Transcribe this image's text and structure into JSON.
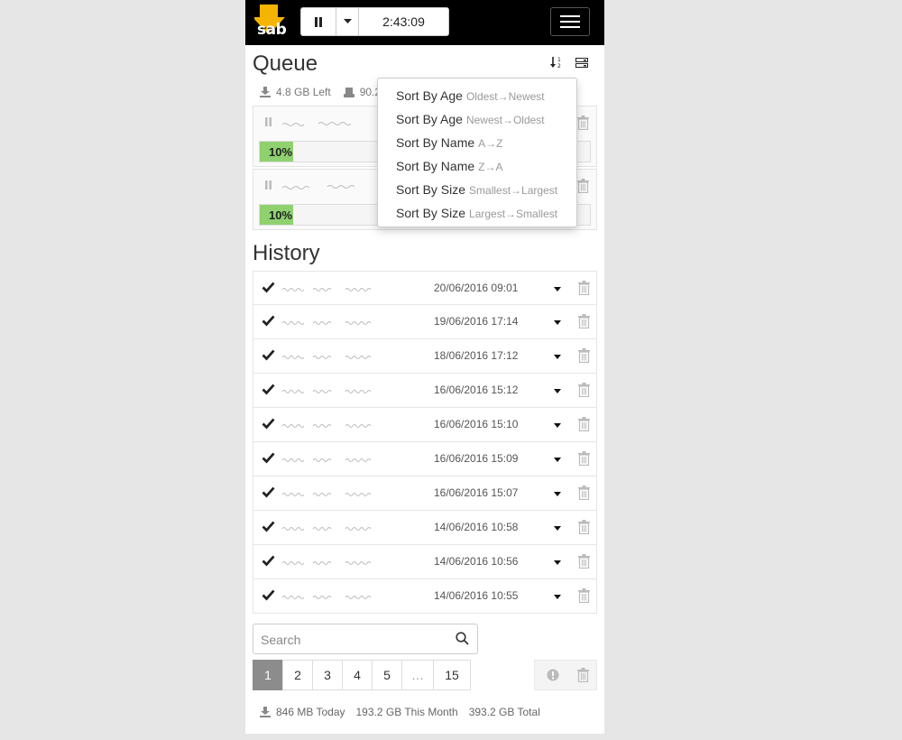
{
  "header": {
    "logo_text": "sab",
    "timer": "2:43:09"
  },
  "queue": {
    "title": "Queue",
    "left": "4.8 GB Left",
    "disk": "90.2",
    "items": [
      {
        "percent": "10%",
        "progress": 0.1
      },
      {
        "percent": "10%",
        "progress": 0.1
      }
    ]
  },
  "sort_menu": {
    "options": [
      {
        "label": "Sort By Age",
        "sub": "Oldest→Newest"
      },
      {
        "label": "Sort By Age",
        "sub": "Newest→Oldest"
      },
      {
        "label": "Sort By Name",
        "sub": "A→Z"
      },
      {
        "label": "Sort By Name",
        "sub": "Z→A"
      },
      {
        "label": "Sort By Size",
        "sub": "Smallest→Largest"
      },
      {
        "label": "Sort By Size",
        "sub": "Largest→Smallest"
      }
    ]
  },
  "history": {
    "title": "History",
    "rows": [
      {
        "date": "20/06/2016 09:01"
      },
      {
        "date": "19/06/2016 17:14"
      },
      {
        "date": "18/06/2016 17:12"
      },
      {
        "date": "16/06/2016 15:12"
      },
      {
        "date": "16/06/2016 15:10"
      },
      {
        "date": "16/06/2016 15:09"
      },
      {
        "date": "16/06/2016 15:07"
      },
      {
        "date": "14/06/2016 10:58"
      },
      {
        "date": "14/06/2016 10:56"
      },
      {
        "date": "14/06/2016 10:55"
      }
    ]
  },
  "search": {
    "placeholder": "Search"
  },
  "pagination": {
    "pages": [
      "1",
      "2",
      "3",
      "4",
      "5",
      "…",
      "15"
    ],
    "active": "1"
  },
  "totals": {
    "today": "846 MB Today",
    "month": "193.2 GB This Month",
    "total": "393.2 GB Total"
  },
  "colors": {
    "progress": "#8fd16f",
    "logo": "#f5b400",
    "topbar": "#000000"
  }
}
